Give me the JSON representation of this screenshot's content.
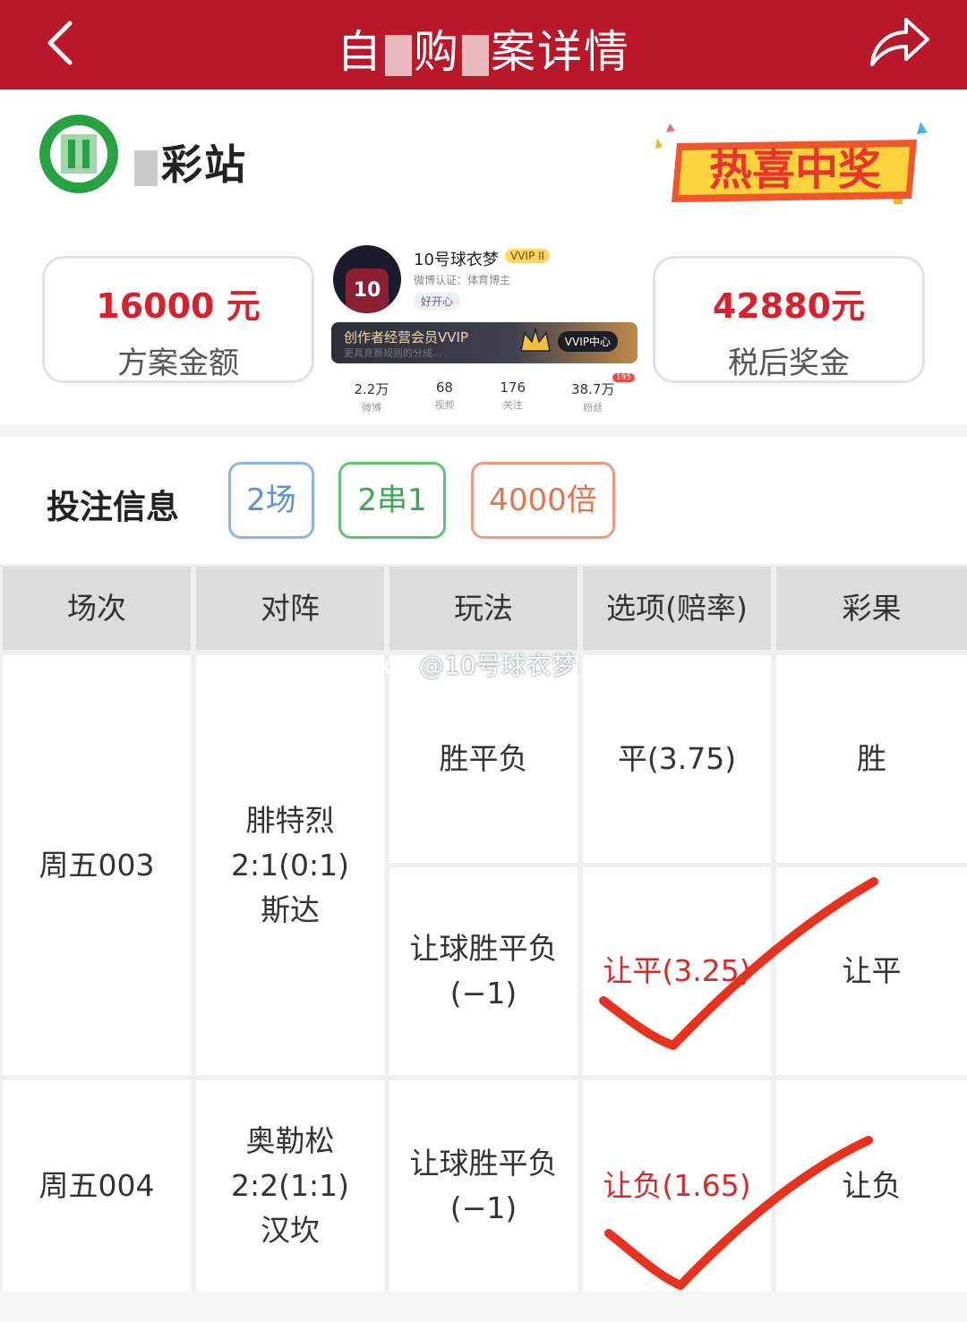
{
  "header": {
    "title_parts": [
      "自",
      "购",
      "案",
      "详情"
    ],
    "bg_color": "#b8182a"
  },
  "brand": {
    "name": "彩站"
  },
  "hot_badge": {
    "text": "热喜中奖"
  },
  "amount_card": {
    "amount": "16000 元",
    "label": "方案金额"
  },
  "prize_card": {
    "amount": "42880元",
    "label": "税后奖金"
  },
  "profile": {
    "avatar_number": "10",
    "name": "10号球衣梦",
    "vip": "VVIP II",
    "cert": "微博认证：体育博主",
    "happy": "好开心",
    "vip_banner": "创作者经营会员VVIP",
    "vip_banner_sub": "更具竞赛规则的分成...",
    "vip_center": "VVIP中心",
    "stats": [
      {
        "num": "2.2万",
        "label": "微博"
      },
      {
        "num": "68",
        "label": "视频"
      },
      {
        "num": "176",
        "label": "关注"
      },
      {
        "num": "38.7万",
        "label": "粉丝"
      }
    ],
    "fans_badge": "195"
  },
  "bet_info": {
    "title": "投注信息",
    "tags": [
      "2场",
      "2串1",
      "4000倍"
    ]
  },
  "table": {
    "headers": [
      "场次",
      "对阵",
      "玩法",
      "选项(赔率)",
      "彩果"
    ],
    "matches": [
      {
        "session": "周五003",
        "team_home": "腓特烈",
        "score": "2:1(0:1)",
        "team_away": "斯达",
        "rows": [
          {
            "play": "胜平负",
            "play_sub": "",
            "option": "平(3.75)",
            "result": "胜",
            "hit": false
          },
          {
            "play": "让球胜平负",
            "play_sub": "(−1)",
            "option": "让平(3.25)",
            "result": "让平",
            "hit": true
          }
        ]
      },
      {
        "session": "周五004",
        "team_home": "奥勒松",
        "score": "2:2(1:1)",
        "team_away": "汉坎",
        "rows": [
          {
            "play": "让球胜平负",
            "play_sub": "(−1)",
            "option": "让负(1.65)",
            "result": "让负",
            "hit": true
          }
        ]
      }
    ]
  },
  "watermark": "@10号球衣梦"
}
